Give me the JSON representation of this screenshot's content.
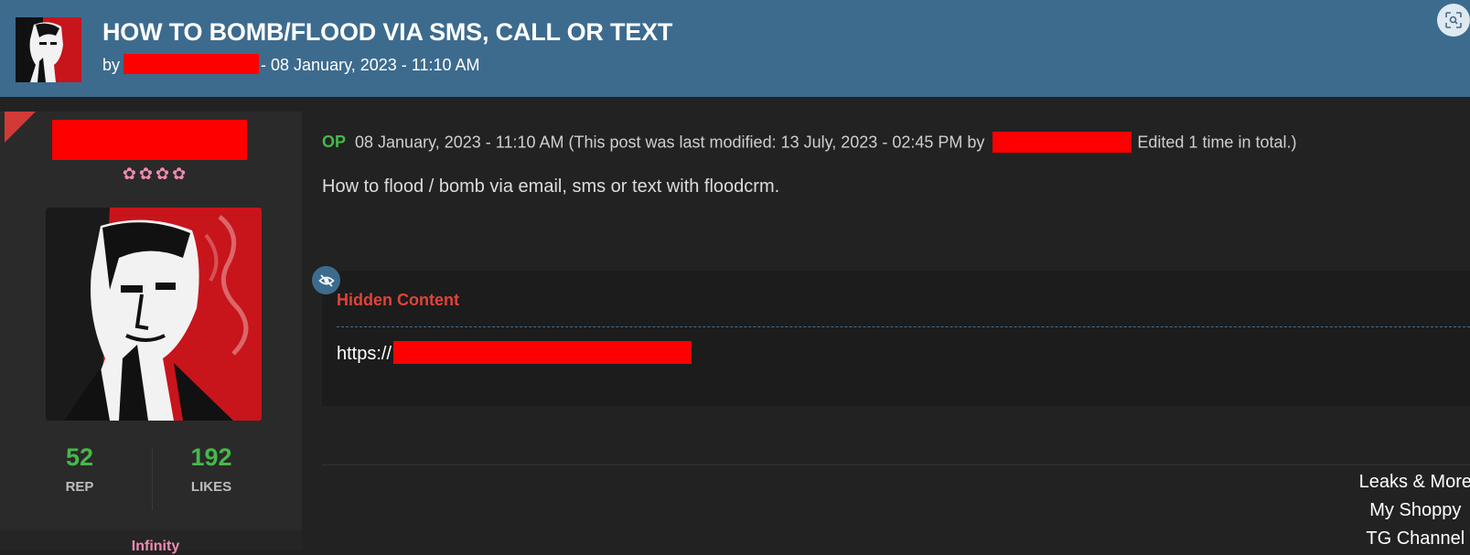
{
  "header": {
    "title": "HOW TO BOMB/FLOOD VIA SMS, CALL OR TEXT",
    "by_label": "by",
    "meta_suffix": "- 08 January, 2023 - 11:10 AM",
    "avatar_icon": "smoking-man-avatar",
    "action_icon": "scan-icon"
  },
  "author": {
    "stars": "✿✿✿✿",
    "avatar_icon": "smoking-man-avatar",
    "stats": [
      {
        "value": "52",
        "label": "REP"
      },
      {
        "value": "192",
        "label": "LIKES"
      }
    ],
    "rank": "Infinity"
  },
  "post": {
    "op_badge": "OP",
    "meta_text": "08 January, 2023 - 11:10 AM (This post was last modified: 13 July, 2023 - 02:45 PM by",
    "edited_text": "Edited 1 time in total.)",
    "body": "How to flood / bomb via email, sms or text with floodcrm.",
    "hidden": {
      "icon": "eye-slash-icon",
      "title": "Hidden Content",
      "link_prefix": "https://"
    },
    "signature": [
      "Leaks & More",
      "My Shoppy",
      "TG Channel"
    ]
  },
  "colors": {
    "header_bg": "#3d6b8e",
    "page_bg": "#222222",
    "op_green": "#46b94a",
    "hidden_red": "#e0433b",
    "redaction": "#ff0000",
    "rank_pink": "#f08ab2"
  }
}
